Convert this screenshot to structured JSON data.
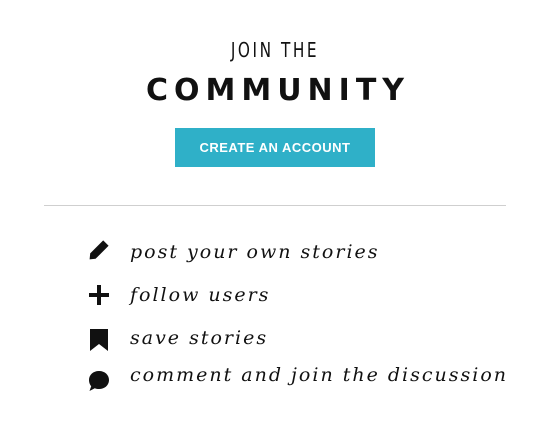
{
  "header": {
    "eyebrow": "JOIN THE",
    "title": "COMMUNITY"
  },
  "cta": {
    "label": "CREATE AN ACCOUNT"
  },
  "colors": {
    "accent": "#2fb0c8",
    "text": "#111111",
    "divider": "#cfcfcf"
  },
  "features": [
    {
      "icon": "pencil-icon",
      "label": "post your own stories"
    },
    {
      "icon": "plus-icon",
      "label": "follow users"
    },
    {
      "icon": "bookmark-icon",
      "label": "save stories"
    },
    {
      "icon": "speech-bubble-icon",
      "label": "comment and join the discussion"
    }
  ]
}
